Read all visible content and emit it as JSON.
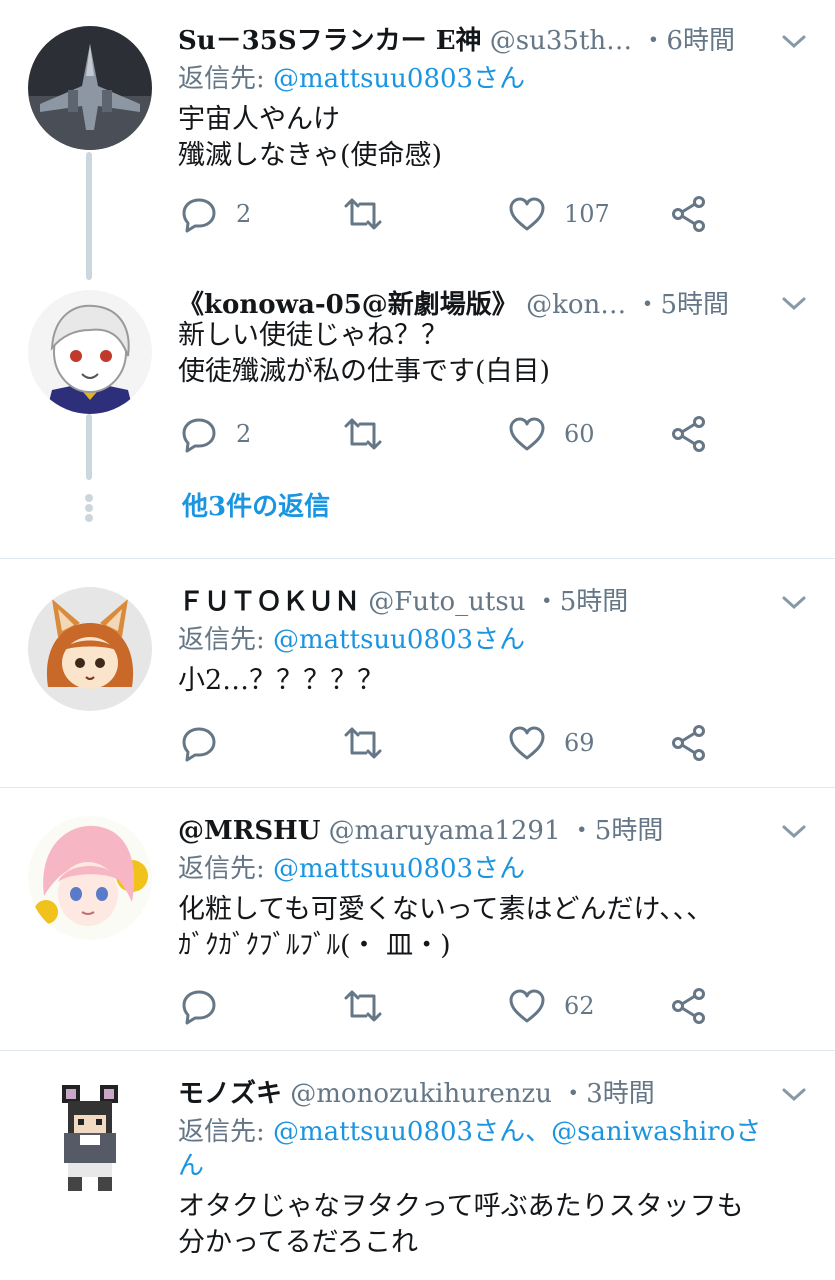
{
  "tweets": [
    {
      "display_name": "Su－35Sフランカー E神",
      "handle": "@su35th…",
      "time": "・6時間",
      "reply_label": "返信先:",
      "reply_to": "@mattsuu0803さん",
      "text": "宇宙人やんけ\n殲滅しなきゃ(使命感)",
      "replies": "2",
      "likes": "107",
      "avatar_icon": "fighter-jet-avatar"
    },
    {
      "display_name": "《konowa-05@新劇場版》",
      "handle": "@kon…",
      "time": "・5時間",
      "text": "新しい使徒じゃね？？\n使徒殲滅が私の仕事です(白目)",
      "replies": "2",
      "likes": "60",
      "avatar_icon": "white-hair-character-avatar"
    },
    {
      "display_name": "ＦＵＴＯＫＵＮ",
      "handle": "@Futo_utsu",
      "time": "・5時間",
      "reply_label": "返信先:",
      "reply_to": "@mattsuu0803さん",
      "text": "小2…？？？？？",
      "replies": "",
      "likes": "69",
      "avatar_icon": "fox-girl-avatar"
    },
    {
      "display_name": "@MRSHU",
      "handle": "@maruyama1291",
      "time": "・5時間",
      "reply_label": "返信先:",
      "reply_to": "@mattsuu0803さん",
      "text": "化粧しても可愛くないって素はどんだけ、、、\nｶﾞｸｶﾞｸﾌﾞﾙﾌﾞﾙ(・ 皿・)",
      "replies": "",
      "likes": "62",
      "avatar_icon": "pink-hair-girl-avatar"
    },
    {
      "display_name": "モノズキ",
      "handle": "@monozukihurenzu",
      "time": "・3時間",
      "reply_label": "返信先:",
      "reply_to": "@mattsuu0803さん、@saniwashiroさ",
      "reply_to_cont": "ん",
      "text": "オタクじゃなヲタクって呼ぶあたりスタッフも\n分かってるだろこれ",
      "avatar_icon": "pixel-mouse-avatar"
    }
  ],
  "thread": {
    "more_replies": "他3件の返信"
  },
  "colors": {
    "link": "#1b95e0",
    "secondary": "#657786",
    "separator": "#e1e8ed",
    "thread_line": "#ccd6dd"
  }
}
